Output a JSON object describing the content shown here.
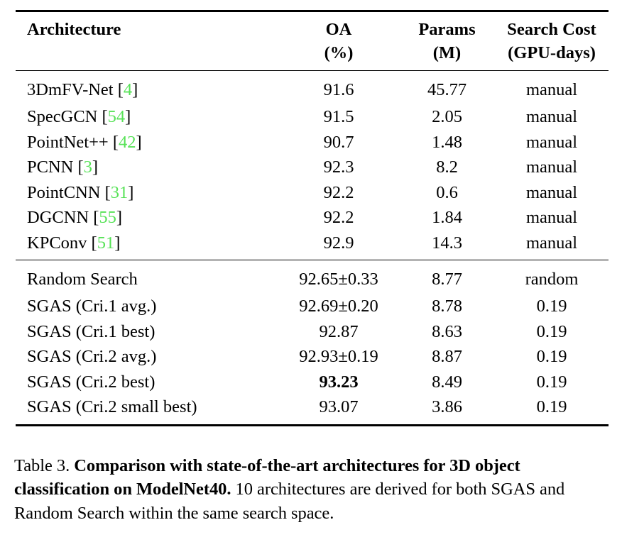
{
  "table": {
    "id": "table-3",
    "accent_citation_color": "#57e257",
    "columns": [
      {
        "key": "architecture",
        "header_line1": "Architecture",
        "header_line2": "",
        "align": "left"
      },
      {
        "key": "oa",
        "header_line1": "OA",
        "header_line2": "(%)",
        "align": "center"
      },
      {
        "key": "params",
        "header_line1": "Params",
        "header_line2": "(M)",
        "align": "center"
      },
      {
        "key": "search_cost",
        "header_line1": "Search Cost",
        "header_line2": "(GPU-days)",
        "align": "center"
      }
    ],
    "blocks": [
      {
        "name": "state-of-the-art-manual",
        "rows": [
          {
            "architecture": "3DmFV-Net",
            "citation": "4",
            "oa": "91.6",
            "oa_bold": false,
            "params": "45.77",
            "search_cost": "manual"
          },
          {
            "architecture": "SpecGCN",
            "citation": "54",
            "oa": "91.5",
            "oa_bold": false,
            "params": "2.05",
            "search_cost": "manual"
          },
          {
            "architecture": "PointNet++",
            "citation": "42",
            "oa": "90.7",
            "oa_bold": false,
            "params": "1.48",
            "search_cost": "manual"
          },
          {
            "architecture": "PCNN",
            "citation": "3",
            "oa": "92.3",
            "oa_bold": false,
            "params": "8.2",
            "search_cost": "manual"
          },
          {
            "architecture": "PointCNN",
            "citation": "31",
            "oa": "92.2",
            "oa_bold": false,
            "params": "0.6",
            "search_cost": "manual"
          },
          {
            "architecture": "DGCNN",
            "citation": "55",
            "oa": "92.2",
            "oa_bold": false,
            "params": "1.84",
            "search_cost": "manual"
          },
          {
            "architecture": "KPConv",
            "citation": "51",
            "oa": "92.9",
            "oa_bold": false,
            "params": "14.3",
            "search_cost": "manual"
          }
        ]
      },
      {
        "name": "searched-architectures",
        "rows": [
          {
            "architecture": "Random Search",
            "citation": "",
            "oa": "92.65±0.33",
            "oa_bold": false,
            "params": "8.77",
            "search_cost": "random"
          },
          {
            "architecture": "SGAS (Cri.1 avg.)",
            "citation": "",
            "oa": "92.69±0.20",
            "oa_bold": false,
            "params": "8.78",
            "search_cost": "0.19"
          },
          {
            "architecture": "SGAS (Cri.1 best)",
            "citation": "",
            "oa": "92.87",
            "oa_bold": false,
            "params": "8.63",
            "search_cost": "0.19"
          },
          {
            "architecture": "SGAS (Cri.2 avg.)",
            "citation": "",
            "oa": "92.93±0.19",
            "oa_bold": false,
            "params": "8.87",
            "search_cost": "0.19"
          },
          {
            "architecture": "SGAS (Cri.2 best)",
            "citation": "",
            "oa": "93.23",
            "oa_bold": true,
            "params": "8.49",
            "search_cost": "0.19"
          },
          {
            "architecture": "SGAS (Cri.2 small best)",
            "citation": "",
            "oa": "93.07",
            "oa_bold": false,
            "params": "3.86",
            "search_cost": "0.19"
          }
        ]
      }
    ]
  },
  "caption": {
    "label": "Table 3.",
    "bold_text": "Comparison with state-of-the-art architectures for 3D object classification on ModelNet40.",
    "rest_text": "10 architectures are derived for both SGAS and Random Search within the same search space."
  }
}
